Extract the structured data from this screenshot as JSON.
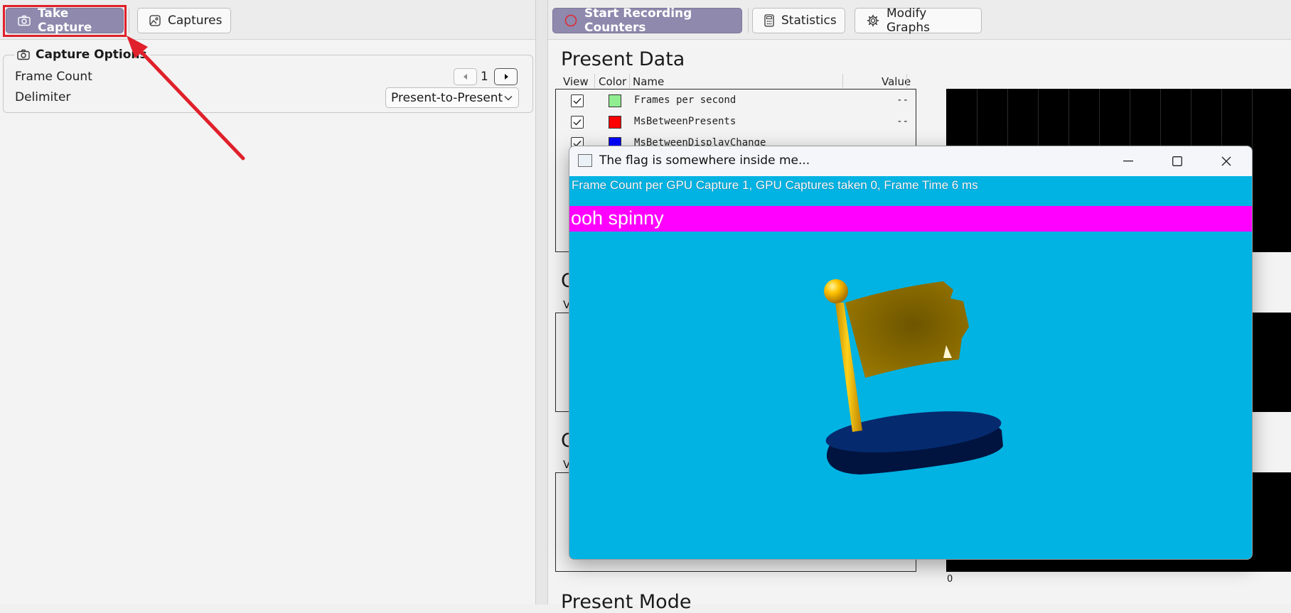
{
  "left": {
    "toolbar": {
      "take_capture": "Take Capture",
      "captures": "Captures"
    },
    "capture_options": {
      "title": "Capture Options",
      "frame_count_label": "Frame Count",
      "frame_count_value": "1",
      "delimiter_label": "Delimiter",
      "delimiter_value": "Present-to-Present"
    }
  },
  "right": {
    "toolbar": {
      "start_recording": "Start Recording Counters",
      "statistics": "Statistics",
      "modify_graphs": "Modify Graphs"
    },
    "present_data": {
      "title": "Present Data",
      "columns": [
        "View",
        "Color",
        "Name",
        "Value"
      ],
      "rows": [
        {
          "name": "Frames per second",
          "value": "--",
          "color": "#90ee90",
          "checked": true
        },
        {
          "name": "MsBetweenPresents",
          "value": "--",
          "color": "#ff0000",
          "checked": true
        },
        {
          "name": "MsBetweenDisplayChange",
          "value": "",
          "color": "#0000ff",
          "checked": true
        }
      ]
    },
    "section2": {
      "title": "C",
      "sub": "V"
    },
    "section3": {
      "title": "C",
      "sub": "V"
    },
    "axis_zero": "0",
    "present_mode_title": "Present Mode"
  },
  "window": {
    "title": "The flag is somewhere inside me...",
    "status": "Frame Count per GPU Capture 1, GPU Captures taken 0, Frame Time 6 ms",
    "banner": "ooh spinny"
  },
  "colors": {
    "accent": "#8e89ad",
    "highlight": "#e0202a",
    "window_bg": "#00b3e3",
    "banner": "#ff00ff"
  }
}
